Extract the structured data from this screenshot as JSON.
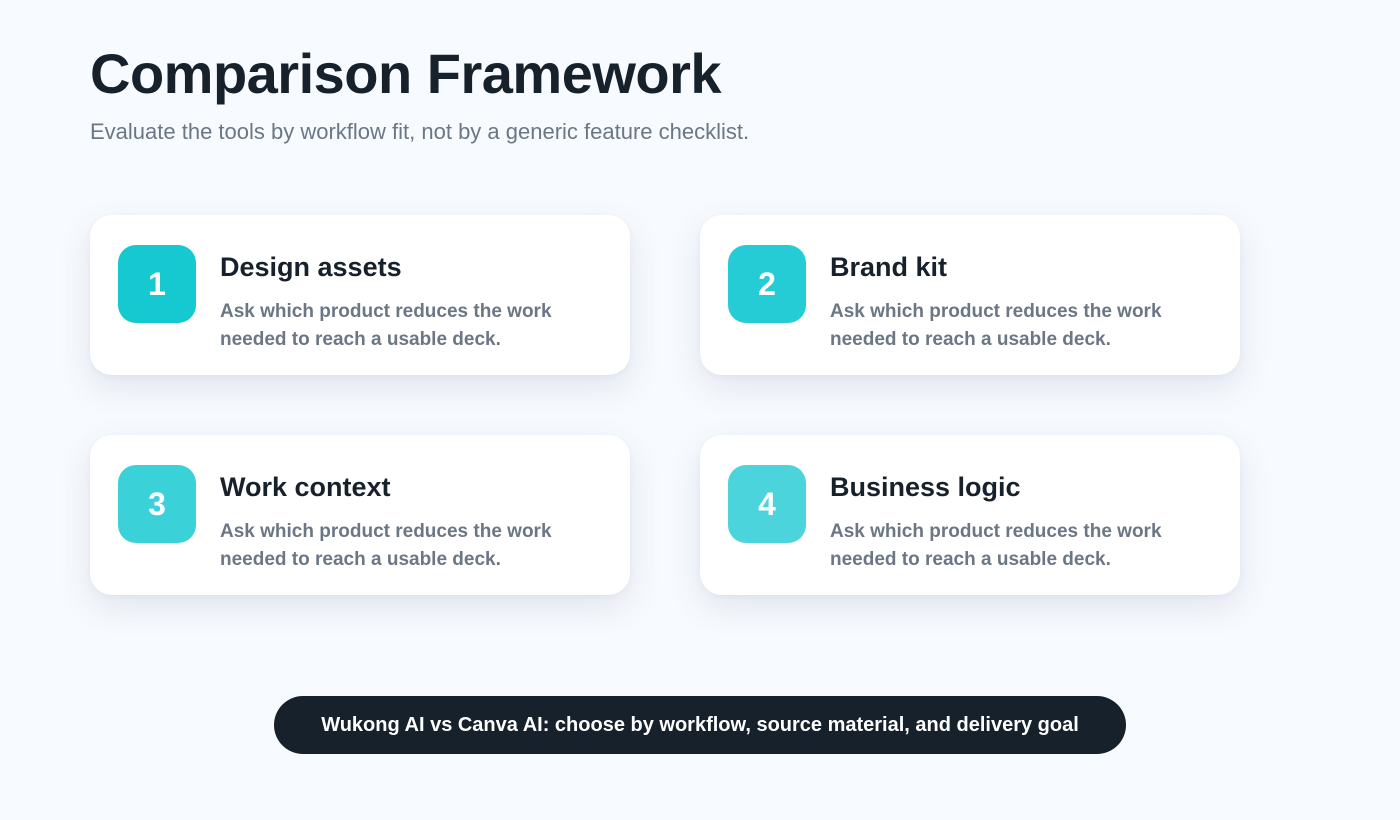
{
  "header": {
    "title": "Comparison Framework",
    "subtitle": "Evaluate the tools by workflow fit, not by a generic feature checklist."
  },
  "cards": [
    {
      "number": "1",
      "title": "Design assets",
      "description": "Ask which product reduces the work needed to reach a usable deck.",
      "badge_color": "#16c8d0"
    },
    {
      "number": "2",
      "title": "Brand kit",
      "description": "Ask which product reduces the work needed to reach a usable deck.",
      "badge_color": "#25ccd6"
    },
    {
      "number": "3",
      "title": "Work context",
      "description": "Ask which product reduces the work needed to reach a usable deck.",
      "badge_color": "#3ad1d9"
    },
    {
      "number": "4",
      "title": "Business logic",
      "description": "Ask which product reduces the work needed to reach a usable deck.",
      "badge_color": "#4cd4dc"
    }
  ],
  "footer": {
    "label": "Wukong AI vs Canva AI: choose by workflow, source material, and delivery goal"
  },
  "colors": {
    "background": "#f7fafe",
    "text_primary": "#17212b",
    "text_secondary": "#6b7785",
    "pill_background": "#17212b"
  }
}
